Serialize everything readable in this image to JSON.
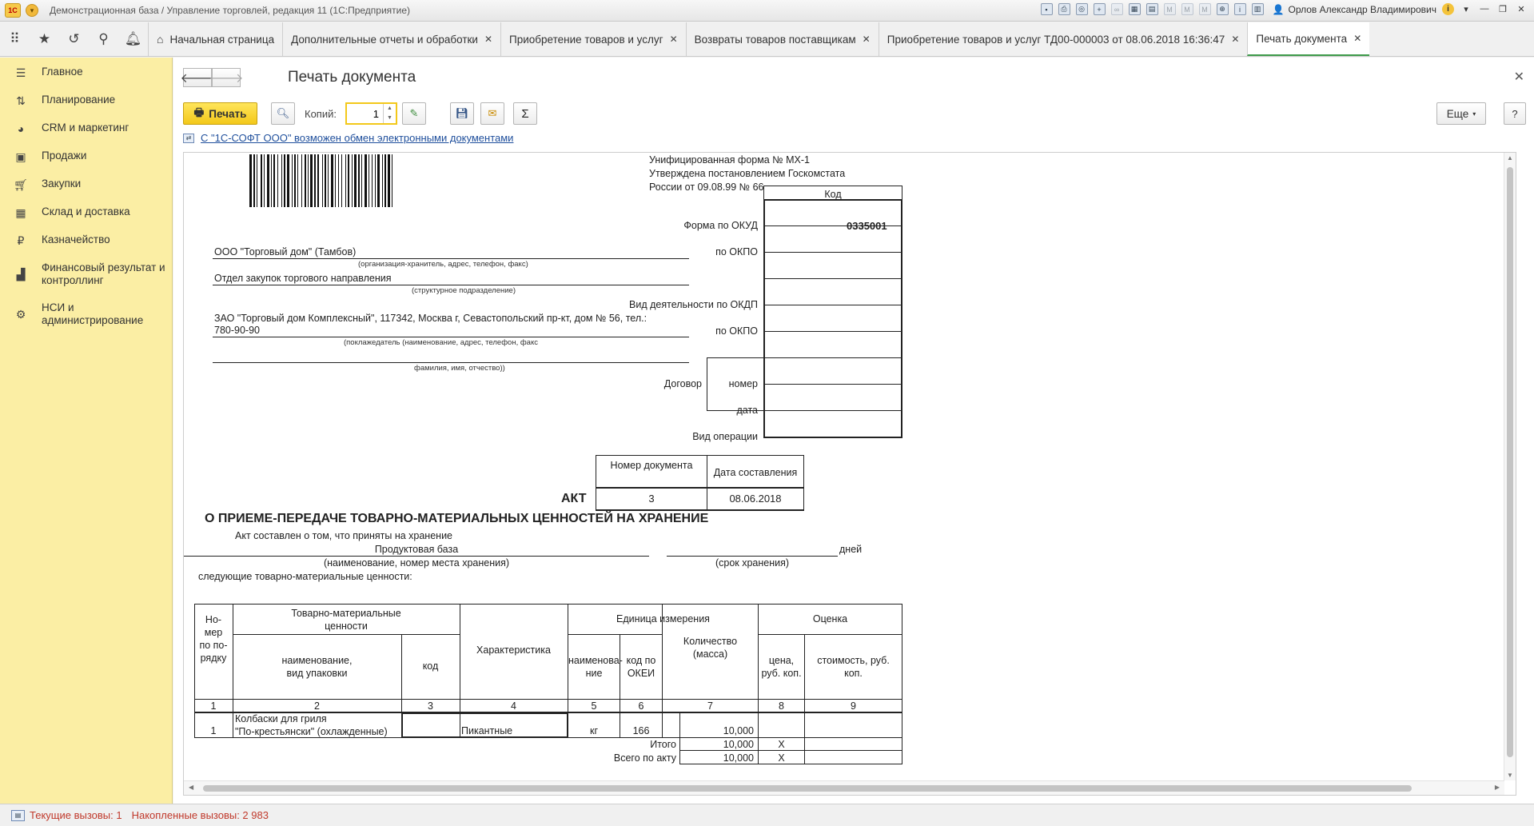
{
  "window": {
    "title": "Демонстрационная база / Управление торговлей, редакция 11  (1С:Предприятие)",
    "logo_text": "1С",
    "user": "Орлов Александр Владимирович"
  },
  "tabs": [
    {
      "label": "Начальная страница",
      "closable": false
    },
    {
      "label": "Дополнительные отчеты и обработки",
      "closable": true
    },
    {
      "label": "Приобретение товаров и услуг",
      "closable": true
    },
    {
      "label": "Возвраты товаров поставщикам",
      "closable": true
    },
    {
      "label": "Приобретение товаров и услуг ТД00-000003 от 08.06.2018 16:36:47",
      "closable": true
    },
    {
      "label": "Печать документа",
      "closable": true,
      "active": true
    }
  ],
  "sidebar": {
    "items": [
      {
        "label": "Главное",
        "icon": "menu-icon"
      },
      {
        "label": "Планирование",
        "icon": "planning-icon"
      },
      {
        "label": "CRM и маркетинг",
        "icon": "pie-chart-icon"
      },
      {
        "label": "Продажи",
        "icon": "bag-icon"
      },
      {
        "label": "Закупки",
        "icon": "cart-icon"
      },
      {
        "label": "Склад и доставка",
        "icon": "warehouse-icon"
      },
      {
        "label": "Казначейство",
        "icon": "ruble-icon"
      },
      {
        "label": "Финансовый результат и контроллинг",
        "icon": "bar-chart-icon"
      },
      {
        "label": "НСИ и администрирование",
        "icon": "gear-icon"
      }
    ]
  },
  "page": {
    "title": "Печать документа",
    "print_label": "Печать",
    "copies_label": "Копий:",
    "copies_value": "1",
    "more_label": "Еще",
    "help_label": "?",
    "edi_link": "С \"1С-СОФТ ООО\" возможен обмен электронными документами"
  },
  "doc": {
    "form_header_1": "Унифицированная форма № МХ-1",
    "form_header_2": "Утверждена постановлением Госкомстата",
    "form_header_3": "России от 09.08.99 № 66",
    "kod_header": "Код",
    "okud_label": "Форма по ОКУД",
    "okud_value": "0335001",
    "okpo_label_1": "по ОКПО",
    "okdp_label": "Вид деятельности по ОКДП",
    "okpo_label_2": "по ОКПО",
    "contract_label": "Договор",
    "contract_number_label": "номер",
    "contract_date_label": "дата",
    "operation_label": "Вид операции",
    "org_name": "ООО \"Торговый дом\" (Тамбов)",
    "org_caption": "(организация-хранитель, адрес, телефон, факс)",
    "dept_name": "Отдел закупок торгового направления",
    "dept_caption": "(структурное подразделение)",
    "depositor_line1": "ЗАО \"Торговый дом Комплексный\", 117342, Москва г, Севастопольский пр-кт, дом № 56, тел.:",
    "depositor_line2": "780-90-90",
    "depositor_caption": "(поклажедатель (наименование, адрес, телефон, факс",
    "fio_caption": "фамилия, имя, отчество))",
    "doc_number_header": "Номер документа",
    "doc_date_header": "Дата составления",
    "doc_number": "3",
    "doc_date": "08.06.2018",
    "act_word": "АКТ",
    "act_title": "О ПРИЕМЕ-ПЕРЕДАЧЕ ТОВАРНО-МАТЕРИАЛЬНЫХ ЦЕННОСТЕЙ НА ХРАНЕНИЕ",
    "act_composed": "Акт составлен о том, что приняты на хранение",
    "storage_place": "Продуктовая база",
    "days_label": "дней",
    "storage_caption": "(наименование, номер места хранения)",
    "term_caption": "(срок хранения)",
    "following": "следующие товарно-материальные ценности:",
    "table": {
      "h_num": "Но-\nмер\nпо по-\nрядку",
      "h_tmc": "Товарно-материальные\nценности",
      "h_name": "наименование,\nвид упаковки",
      "h_code": "код",
      "h_char": "Характеристика",
      "h_unit": "Единица измерения",
      "h_unit_name": "наименова-\nние",
      "h_okei": "код по\nОКЕИ",
      "h_qty": "Количество\n(масса)",
      "h_eval": "Оценка",
      "h_price": "цена,\nруб. коп.",
      "h_cost": "стоимость, руб.\nкоп.",
      "col_nums": [
        "1",
        "2",
        "3",
        "4",
        "5",
        "6",
        "7",
        "8",
        "9"
      ],
      "rows": [
        {
          "num": "1",
          "name": "Колбаски для гриля\n\"По-крестьянски\" (охлажденные)",
          "code": "",
          "char": "Пикантные",
          "unit": "кг",
          "okei": "166",
          "qty": "10,000",
          "price": "",
          "cost": ""
        }
      ],
      "total_label": "Итого",
      "total_qty": "10,000",
      "total_x": "X",
      "grand_label": "Всего по акту",
      "grand_qty": "10,000",
      "grand_x": "X"
    }
  },
  "status": {
    "current_calls": "Текущие вызовы: 1",
    "accumulated_calls": "Накопленные вызовы: 2 983"
  }
}
